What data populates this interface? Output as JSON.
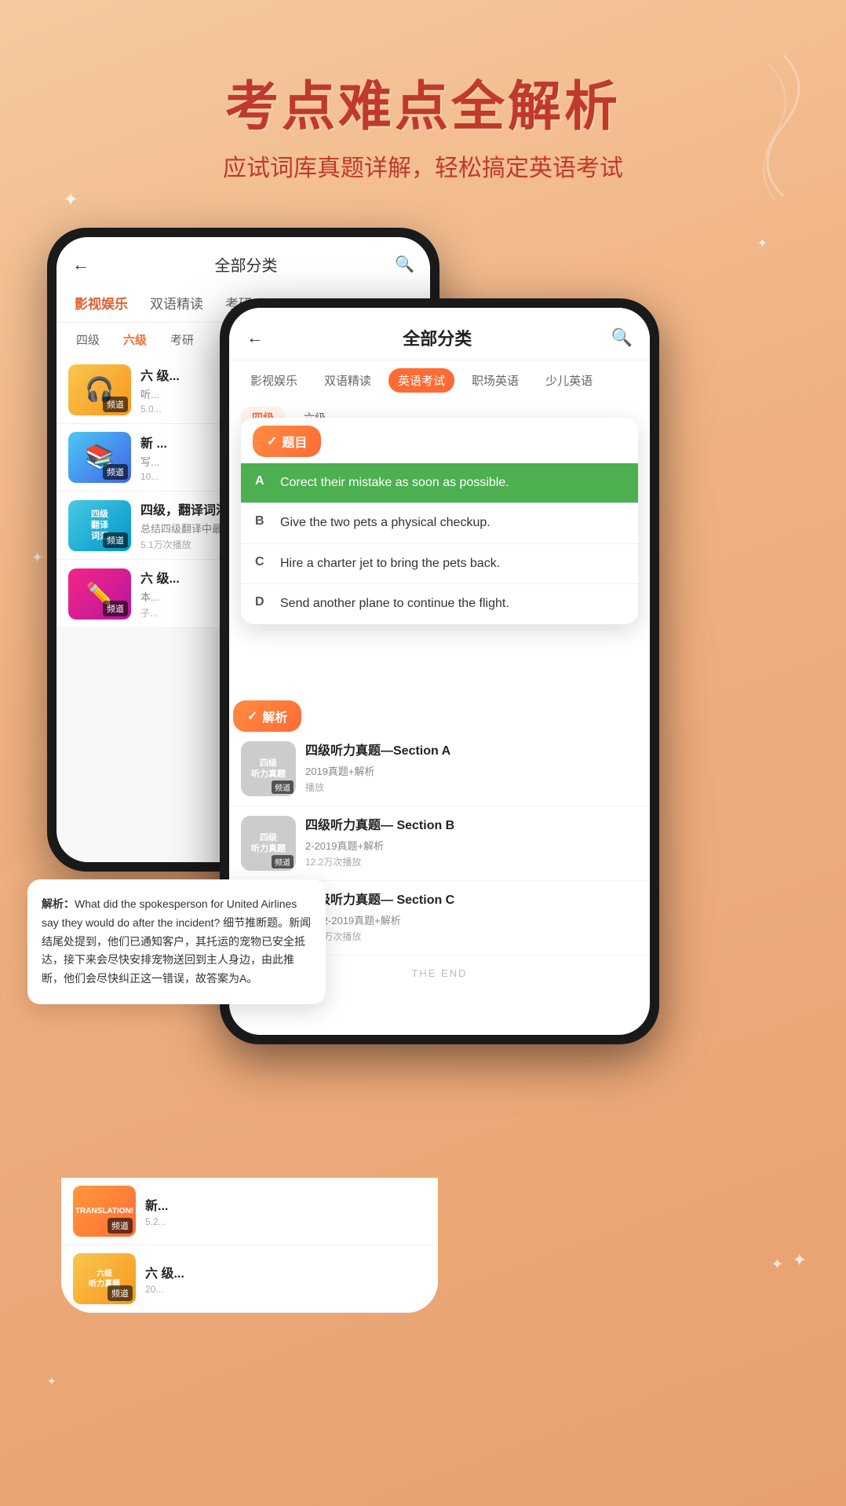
{
  "header": {
    "title": "考点难点全解析",
    "subtitle": "应试词库真题详解，轻松搞定英语考试"
  },
  "back_phone": {
    "nav_title": "全部分类",
    "tabs": [
      "影视娱乐",
      "双语精读",
      "考研"
    ],
    "active_tab": "影视娱乐",
    "subtabs": [
      "四级",
      "六级",
      "考研"
    ],
    "active_subtab": "六级",
    "items": [
      {
        "title": "六级...",
        "desc": "听...",
        "count": "5.0...",
        "label": "频道",
        "thumb_type": "yellow"
      },
      {
        "title": "新...",
        "desc": "写...",
        "count": "10...",
        "label": "频道",
        "thumb_type": "blue"
      },
      {
        "title": "六级...",
        "desc": "本...",
        "count": "子...",
        "label": "频道",
        "thumb_type": "pink"
      }
    ]
  },
  "front_phone": {
    "nav_title": "全部分类",
    "tabs": [
      "影视娱乐",
      "双语精读",
      "英语考试",
      "职场英语",
      "少儿英语"
    ],
    "active_tab": "英语考试",
    "subtabs": [
      "四级",
      "六级"
    ],
    "active_subtab": "四级",
    "question_badge": "题目",
    "options": [
      {
        "letter": "A",
        "text": "Corect their mistake as soon as possible.",
        "correct": true
      },
      {
        "letter": "B",
        "text": "Give the two pets a physical checkup."
      },
      {
        "letter": "C",
        "text": "Hire a charter jet to bring the pets back."
      },
      {
        "letter": "D",
        "text": "Send another plane to continue the flight."
      }
    ],
    "analysis_badge": "解析",
    "analysis_text": "解析：What did the spokesperson for United Airlines say they would do after the incident? 细节推断题。新闻结尾处提到，他们已通知客户，其托运的宠物已安全抵达，接下来会尽快安排宠物送回到主人身边，由此推断，他们会尽快纠正这一错误，故答案为A。",
    "items": [
      {
        "title": "四级听力真题—Section A",
        "desc": "2019真题+解析",
        "count": "播放",
        "thumb_text": "四级\n听力真题",
        "label": "频道",
        "thumb_type": "teal"
      },
      {
        "title": "四级听力真题— Section B",
        "desc": "2-2019真题+解析",
        "count": "12.2万次播放",
        "thumb_text": "四级\n听力真题",
        "label": "频道",
        "thumb_type": "teal"
      },
      {
        "title": "四级听力真题— Section C",
        "desc": "2022-2019真题+解析",
        "count": "12.2万次播放",
        "thumb_text": "四级\n听力真题",
        "label": "频道",
        "thumb_type": "teal"
      }
    ],
    "the_end": "THE END"
  }
}
